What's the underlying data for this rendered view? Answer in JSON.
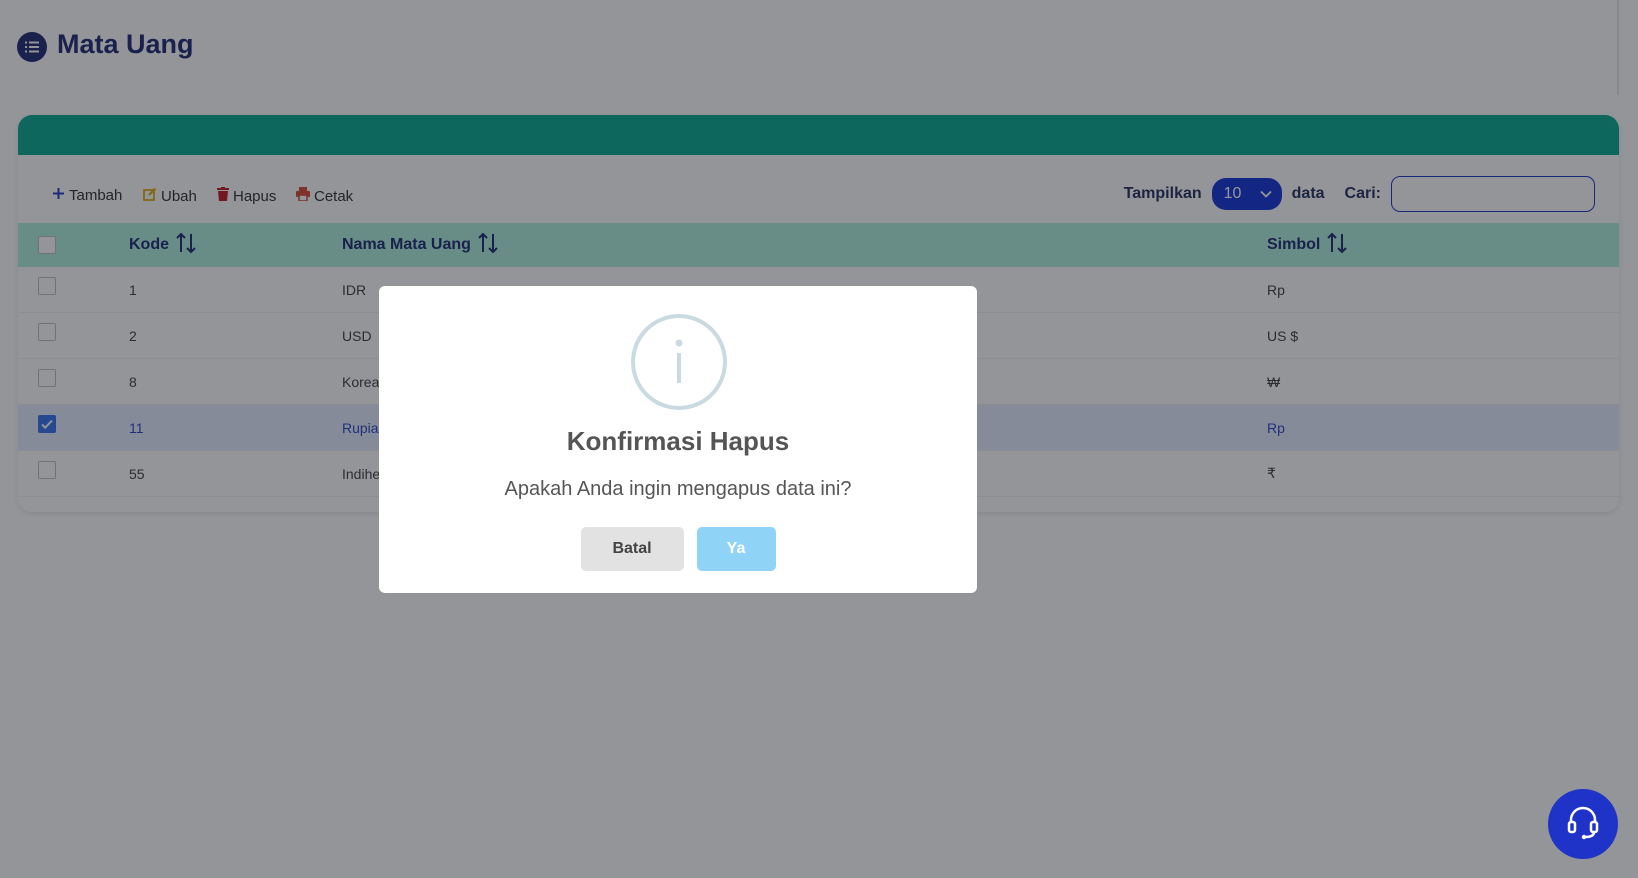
{
  "page": {
    "title": "Mata Uang"
  },
  "toolbar": {
    "add_label": "Tambah",
    "edit_label": "Ubah",
    "delete_label": "Hapus",
    "print_label": "Cetak",
    "show_label": "Tampilkan",
    "page_size": "10",
    "data_label": "data",
    "search_label": "Cari:",
    "search_value": ""
  },
  "table": {
    "columns": [
      "Kode",
      "Nama Mata Uang",
      "Simbol"
    ],
    "rows": [
      {
        "kode": "1",
        "nama": "IDR",
        "simbol": "Rp",
        "checked": false
      },
      {
        "kode": "2",
        "nama": "USD",
        "simbol": "US $",
        "checked": false
      },
      {
        "kode": "8",
        "nama": "Korea",
        "simbol": "₩",
        "checked": false
      },
      {
        "kode": "11",
        "nama": "Rupia",
        "simbol": "Rp",
        "checked": true
      },
      {
        "kode": "55",
        "nama": "Indihe",
        "simbol": "₹",
        "checked": false
      }
    ]
  },
  "dialog": {
    "title": "Konfirmasi Hapus",
    "message": "Apakah Anda ingin mengapus data ini?",
    "cancel_label": "Batal",
    "confirm_label": "Ya"
  },
  "icons": {
    "title": "list-icon",
    "add": "plus-icon",
    "edit": "edit-icon",
    "delete": "trash-icon",
    "print": "printer-icon",
    "sort": "sort-icon",
    "info": "info-icon",
    "help": "headset-icon"
  },
  "colors": {
    "brand_navy": "#17246e",
    "card_header": "#00a88f",
    "table_header": "#adf0dd",
    "select_blue": "#0f2fd6",
    "selected_row": "#e4ecff",
    "confirm_button": "#8fd3f7",
    "help_button": "#1f33c9"
  }
}
